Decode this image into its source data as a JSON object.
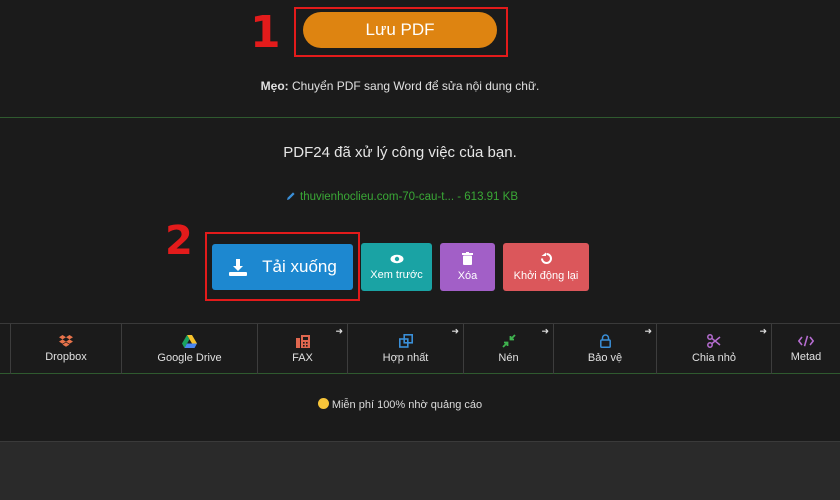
{
  "annotations": {
    "step1": "1",
    "step2": "2",
    "color": "#e31b1b"
  },
  "save_button": {
    "label": "Lưu PDF",
    "color": "#de8411"
  },
  "tip": {
    "prefix": "Mẹo:",
    "text": " Chuyển PDF sang Word để sửa nội dung chữ."
  },
  "result": {
    "message": "PDF24 đã xử lý công việc của bạn.",
    "file_name": "thuvienhoclieu.com-70-cau-t...",
    "file_size": " - 613.91 KB",
    "file_icon": "pencil-icon"
  },
  "actions": {
    "download": {
      "label": "Tải xuống",
      "icon": "download-icon",
      "color": "#1d88d0"
    },
    "preview": {
      "label": "Xem trước",
      "icon": "eye-icon",
      "color": "#1aa3a4"
    },
    "delete": {
      "label": "Xóa",
      "icon": "trash-icon",
      "color": "#a25fc7"
    },
    "restart": {
      "label": "Khởi động lại",
      "icon": "restart-icon",
      "color": "#db575b"
    }
  },
  "tools": [
    {
      "label": "Dropbox",
      "icon": "dropbox-icon",
      "arrow": false
    },
    {
      "label": "Google Drive",
      "icon": "google-drive-icon",
      "arrow": false
    },
    {
      "label": "FAX",
      "icon": "fax-icon",
      "arrow": true
    },
    {
      "label": "Hợp nhất",
      "icon": "merge-icon",
      "arrow": true
    },
    {
      "label": "Nén",
      "icon": "compress-icon",
      "arrow": true
    },
    {
      "label": "Bảo vệ",
      "icon": "lock-icon",
      "arrow": true
    },
    {
      "label": "Chia nhỏ",
      "icon": "scissors-icon",
      "arrow": true
    },
    {
      "label": "Metad",
      "icon": "code-icon",
      "arrow": false
    }
  ],
  "ad_note": {
    "text": "Miễn phí 100% nhờ quảng cáo",
    "icon": "smile-icon"
  }
}
